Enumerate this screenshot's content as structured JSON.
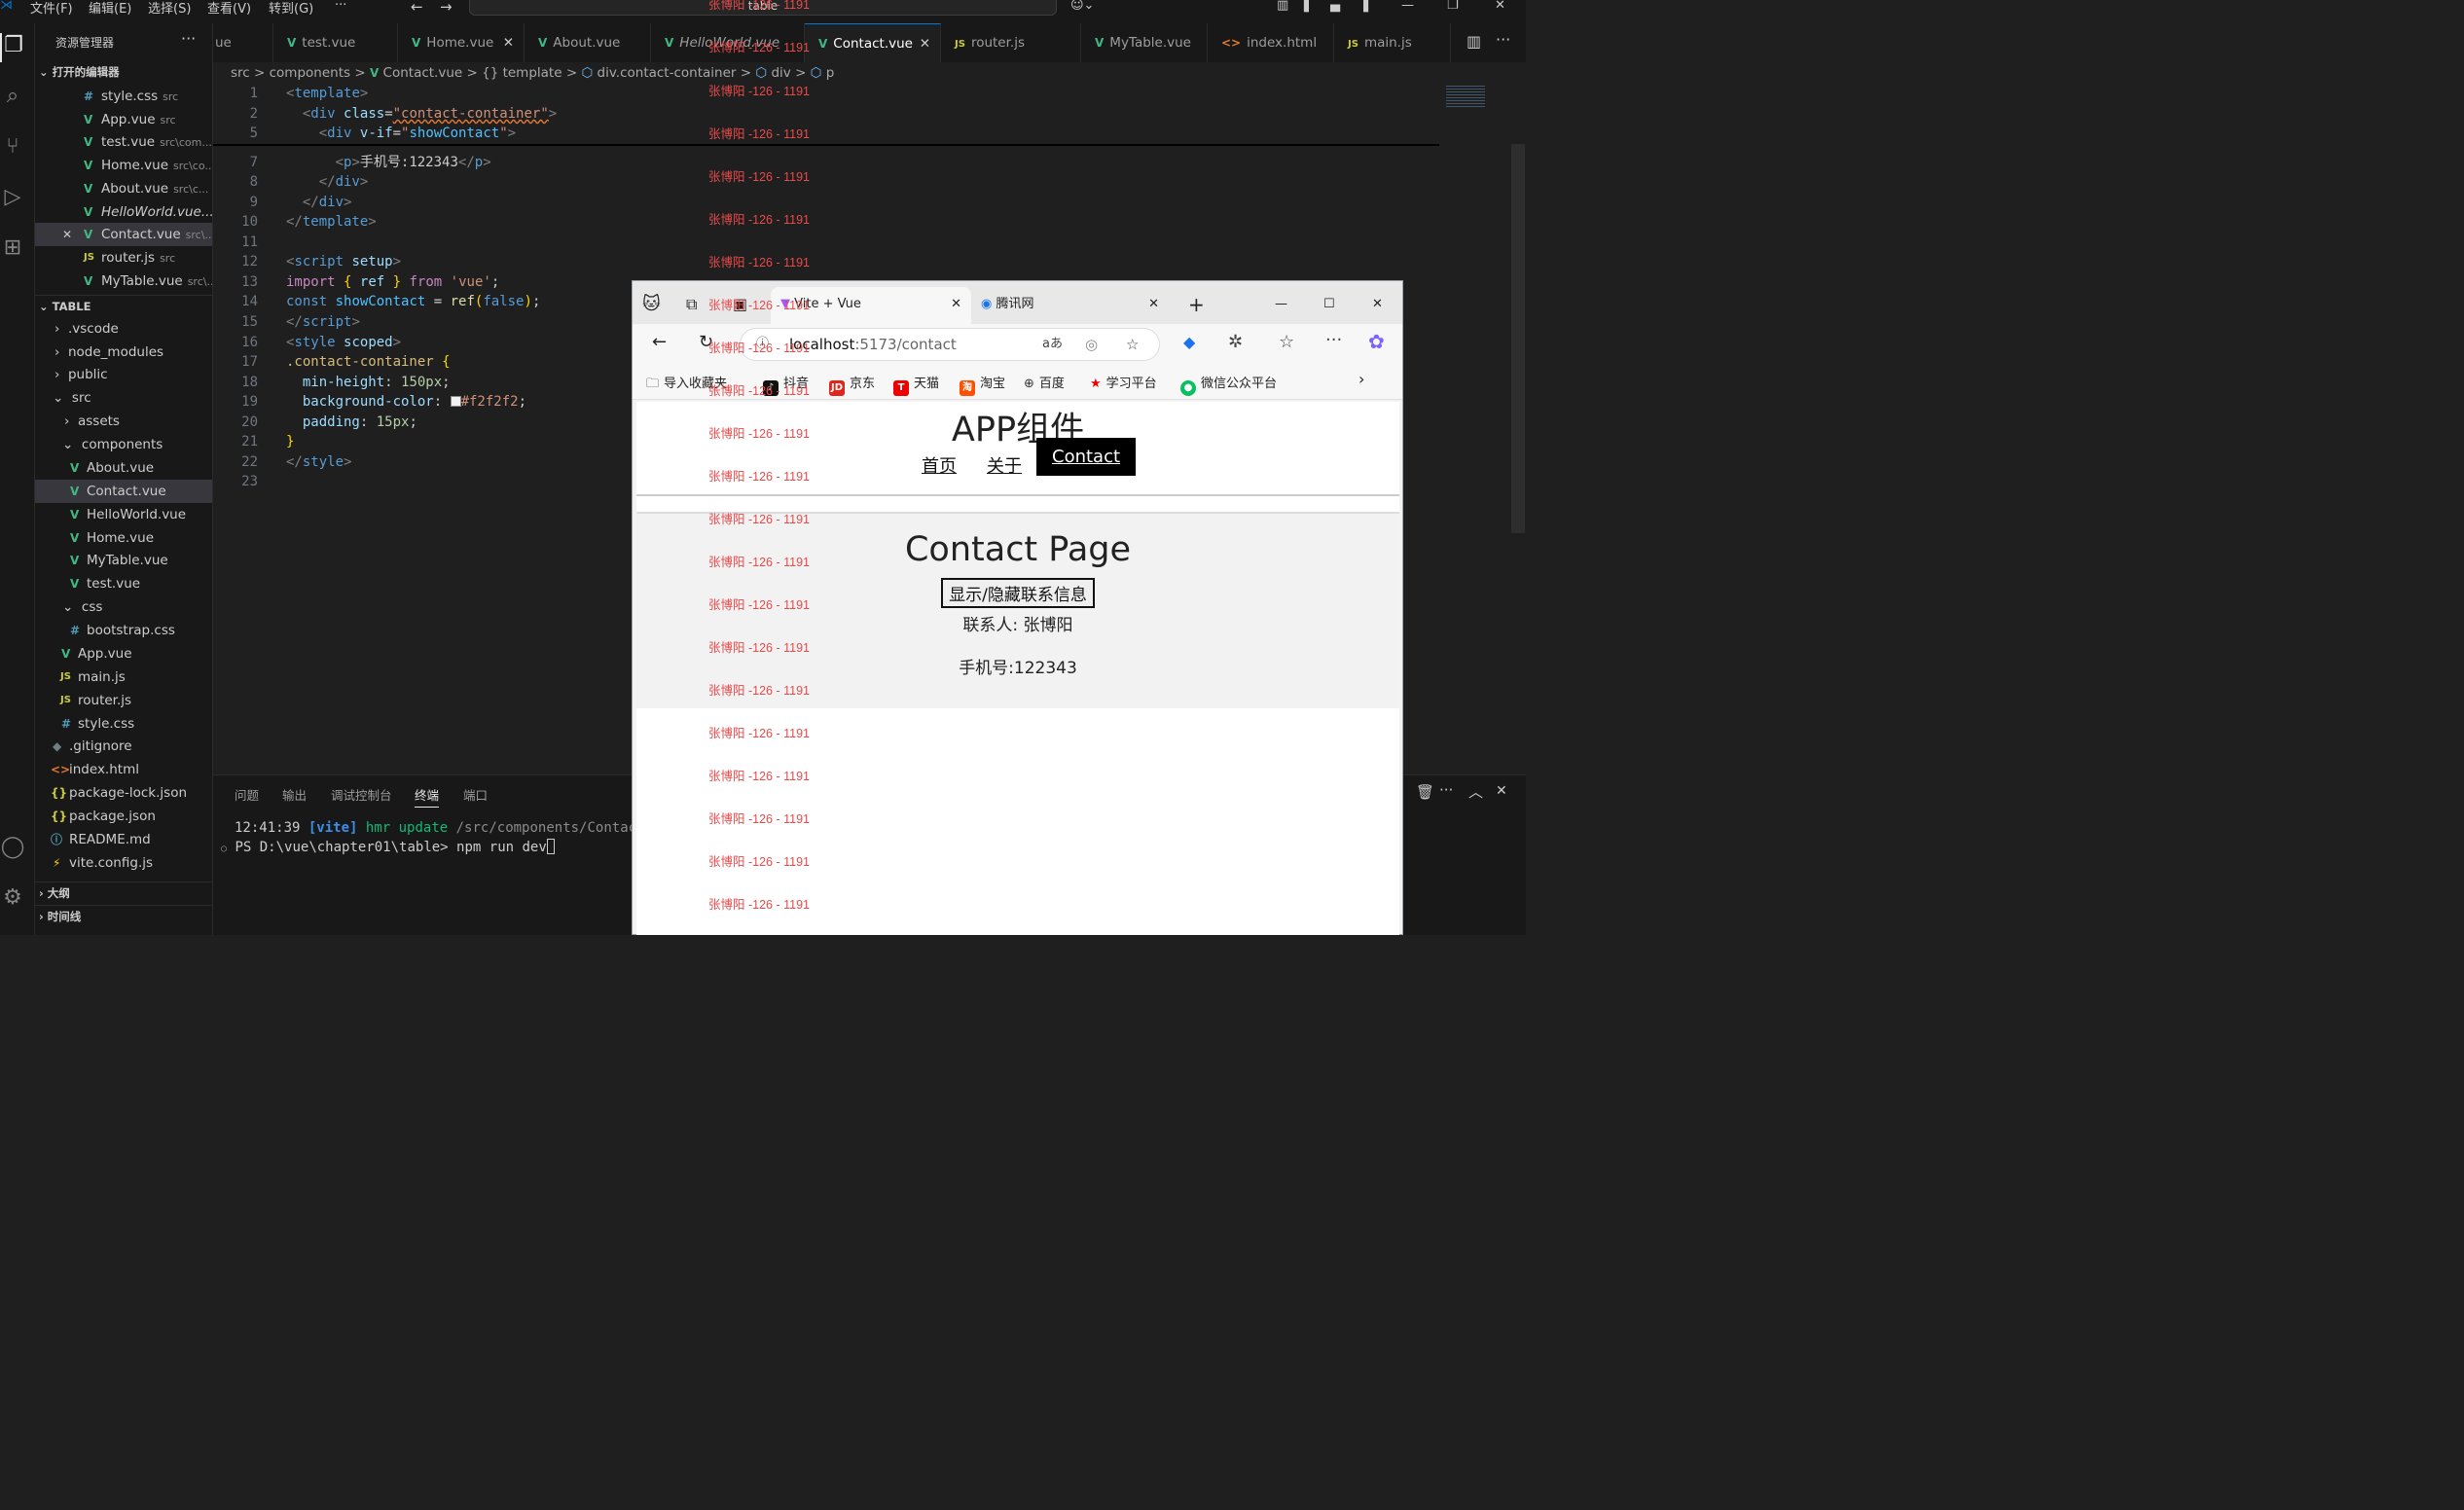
{
  "menu": {
    "items": [
      "文件(F)",
      "编辑(E)",
      "选择(S)",
      "查看(V)",
      "转到(G)",
      "···"
    ],
    "search": "table"
  },
  "explorer": {
    "title": "资源管理器",
    "open_editors_title": "打开的编辑器",
    "open_editors": [
      {
        "icon": "#",
        "name": "style.css",
        "hint": "src"
      },
      {
        "icon": "V",
        "name": "App.vue",
        "hint": "src"
      },
      {
        "icon": "V",
        "name": "test.vue",
        "hint": "src\\com..."
      },
      {
        "icon": "V",
        "name": "Home.vue",
        "hint": "src\\co..."
      },
      {
        "icon": "V",
        "name": "About.vue",
        "hint": "src\\c..."
      },
      {
        "icon": "V",
        "name": "HelloWorld.vue..."
      },
      {
        "icon": "V",
        "name": "Contact.vue",
        "hint": "src\\..."
      },
      {
        "icon": "JS",
        "name": "router.js",
        "hint": "src"
      },
      {
        "icon": "V",
        "name": "MyTable.vue",
        "hint": "src\\..."
      }
    ],
    "project_title": "TABLE",
    "tree": [
      {
        "name": ".vscode"
      },
      {
        "name": "node_modules"
      },
      {
        "name": "public"
      },
      {
        "name": "src"
      },
      {
        "name": "assets"
      },
      {
        "name": "components"
      },
      {
        "icon": "V",
        "name": "About.vue"
      },
      {
        "icon": "V",
        "name": "Contact.vue"
      },
      {
        "icon": "V",
        "name": "HelloWorld.vue"
      },
      {
        "icon": "V",
        "name": "Home.vue"
      },
      {
        "icon": "V",
        "name": "MyTable.vue"
      },
      {
        "icon": "V",
        "name": "test.vue"
      },
      {
        "name": "css"
      },
      {
        "icon": "#",
        "name": "bootstrap.css"
      },
      {
        "icon": "V",
        "name": "App.vue"
      },
      {
        "icon": "JS",
        "name": "main.js"
      },
      {
        "icon": "JS",
        "name": "router.js"
      },
      {
        "icon": "#",
        "name": "style.css"
      },
      {
        "icon": "◆",
        "name": ".gitignore"
      },
      {
        "icon": "<>",
        "name": "index.html"
      },
      {
        "icon": "{}",
        "name": "package-lock.json"
      },
      {
        "icon": "{}",
        "name": "package.json"
      },
      {
        "icon": "ⓘ",
        "name": "README.md"
      },
      {
        "icon": "⚡",
        "name": "vite.config.js"
      }
    ],
    "outline": "大纲",
    "timeline": "时间线"
  },
  "tabs": [
    {
      "name": "ue"
    },
    {
      "icon": "V",
      "name": "test.vue"
    },
    {
      "icon": "V",
      "name": "Home.vue"
    },
    {
      "icon": "V",
      "name": "About.vue"
    },
    {
      "icon": "V",
      "name": "HelloWorld.vue"
    },
    {
      "icon": "V",
      "name": "Contact.vue"
    },
    {
      "icon": "JS",
      "name": "router.js"
    },
    {
      "icon": "V",
      "name": "MyTable.vue"
    },
    {
      "icon": "<>",
      "name": "index.html"
    },
    {
      "icon": "JS",
      "name": "main.js"
    }
  ],
  "breadcrumb": [
    "src",
    ">",
    "components",
    ">",
    "Contact.vue",
    ">",
    "{} template",
    ">",
    "div.contact-container",
    ">",
    "div",
    ">",
    "p"
  ],
  "editor": {
    "line_numbers": [
      "1",
      "2",
      "5",
      "7",
      "8",
      "9",
      "10",
      "11",
      "12",
      "13",
      "14",
      "15",
      "16",
      "17",
      "18",
      "19",
      "20",
      "21",
      "22",
      "23"
    ],
    "texts": {
      "l7": "手机号:122343"
    }
  },
  "panel": {
    "tabs": [
      "问题",
      "输出",
      "调试控制台",
      "终端",
      "端口"
    ],
    "term1_time": "12:41:39",
    "term1_vite": "[vite]",
    "term1_msg": "hmr update",
    "term1_path": "/src/components/Contact.",
    "term2": "PS D:\\vue\\chapter01\\table> npm run dev"
  },
  "browser": {
    "tab1": "Vite + Vue",
    "tab2": "腾讯网",
    "url_host": "localhost",
    "url_path": ":5173/contact",
    "favorites": [
      "导入收藏夹",
      "抖音",
      "京东",
      "天猫",
      "淘宝",
      "百度",
      "学习平台",
      "微信公众平台"
    ],
    "page": {
      "app_title": "APP组件",
      "nav": [
        "首页",
        "关于",
        "Contact"
      ],
      "heading": "Contact Page",
      "toggle_button": "显示/隐藏联系信息",
      "contact_person": "联系人: 张博阳",
      "phone": "手机号:122343"
    }
  },
  "watermark": "张博阳 -126 - 1191"
}
